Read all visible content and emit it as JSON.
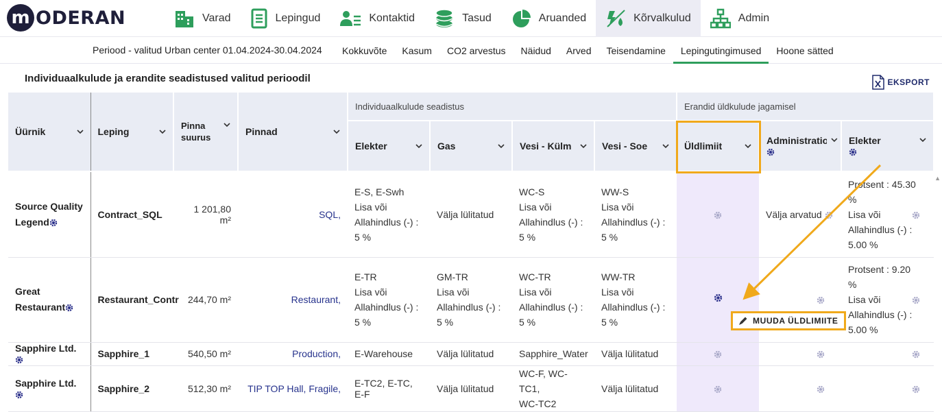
{
  "app": {
    "logo_letter": "m",
    "logo_text": "ODERAN"
  },
  "nav": [
    {
      "label": "Varad",
      "icon": "building-icon"
    },
    {
      "label": "Lepingud",
      "icon": "document-icon"
    },
    {
      "label": "Kontaktid",
      "icon": "contacts-icon"
    },
    {
      "label": "Tasud",
      "icon": "coins-icon"
    },
    {
      "label": "Aruanded",
      "icon": "pie-chart-icon"
    },
    {
      "label": "Kõrvalkulud",
      "icon": "utilities-icon",
      "active": true
    },
    {
      "label": "Admin",
      "icon": "org-chart-icon"
    }
  ],
  "subnav": {
    "period": "Periood - valitud Urban center 01.04.2024-30.04.2024",
    "tabs": [
      "Kokkuvõte",
      "Kasum",
      "CO2 arvestus",
      "Näidud",
      "Arved",
      "Teisendamine",
      "Lepingutingimused",
      "Hoone sätted"
    ],
    "active_tab": "Lepingutingimused"
  },
  "page": {
    "title": "Individuaalkulude ja erandite seadistused valitud perioodil",
    "export_label": "EKSPORT"
  },
  "table": {
    "group_individual": "Individuaalkulude seadistus",
    "group_exceptions": "Erandid üldkulude jagamisel",
    "headers": {
      "tenant": "Üürnik",
      "contract": "Leping",
      "area_size_1": "Pinna",
      "area_size_2": "suurus",
      "areas": "Pinnad",
      "electricity": "Elekter",
      "gas": "Gas",
      "cold_water": "Vesi - Külm",
      "hot_water": "Vesi - Soe",
      "general_limit": "Üldlimiit",
      "administration": "Administratio",
      "electricity_exc": "Elekter"
    },
    "rows": [
      {
        "tenant": "Source Quality Legend",
        "contract": "Contract_SQL",
        "size": "1 201,80 m²",
        "areas": "SQL,",
        "elekter": [
          "E-S, E-Swh",
          "Lisa või",
          "Allahindlus (-) :",
          "5 %"
        ],
        "gas": [
          "Välja lülitatud"
        ],
        "vesi_kylm": [
          "WC-S",
          "Lisa või",
          "Allahindlus (-) :",
          "5 %"
        ],
        "vesi_soe": [
          "WW-S",
          "Lisa või",
          "Allahindlus (-) :",
          "5 %"
        ],
        "admin": "Välja arvatud",
        "elekter_exc": [
          "Protsent : 45.30",
          "%",
          "Lisa või",
          "Allahindlus (-) :",
          "5.00 %"
        ]
      },
      {
        "tenant": "Great Restaurant",
        "contract": "Restaurant_Contr",
        "size": "244,70 m²",
        "areas": "Restaurant,",
        "elekter": [
          "E-TR",
          "Lisa või",
          "Allahindlus (-) :",
          "5 %"
        ],
        "gas": [
          "GM-TR",
          "Lisa või",
          "Allahindlus (-) :",
          "5 %"
        ],
        "vesi_kylm": [
          "WC-TR",
          "Lisa või",
          "Allahindlus (-) :",
          "5 %"
        ],
        "vesi_soe": [
          "WW-TR",
          "Lisa või",
          "Allahindlus (-) :",
          "5 %"
        ],
        "admin": "",
        "elekter_exc": [
          "Protsent : 9.20",
          "%",
          "Lisa või",
          "Allahindlus (-) :",
          "5.00 %"
        ]
      },
      {
        "tenant": "Sapphire Ltd.",
        "contract": "Sapphire_1",
        "size": "540,50 m²",
        "areas": "Production,",
        "elekter": [
          "E-Warehouse"
        ],
        "gas": [
          "Välja lülitatud"
        ],
        "vesi_kylm": [
          "Sapphire_Water"
        ],
        "vesi_soe": [
          "Välja lülitatud"
        ],
        "admin": "",
        "elekter_exc": []
      },
      {
        "tenant": "Sapphire Ltd.",
        "contract": "Sapphire_2",
        "size": "512,30 m²",
        "areas": "TIP TOP Hall, Fragile,",
        "elekter": [
          "E-TC2, E-TC, E-F"
        ],
        "gas": [
          "Välja lülitatud"
        ],
        "vesi_kylm": [
          "WC-F, WC-TC1,",
          "WC-TC2"
        ],
        "vesi_soe": [
          "Välja lülitatud"
        ],
        "admin": "",
        "elekter_exc": []
      }
    ]
  },
  "tooltip": {
    "label": "MUUDA ÜLDLIMIITE"
  },
  "colors": {
    "accent_green": "#2e9e5c",
    "highlight": "#f0a91b",
    "link": "#26328c",
    "lilac": "#efe9fb"
  }
}
